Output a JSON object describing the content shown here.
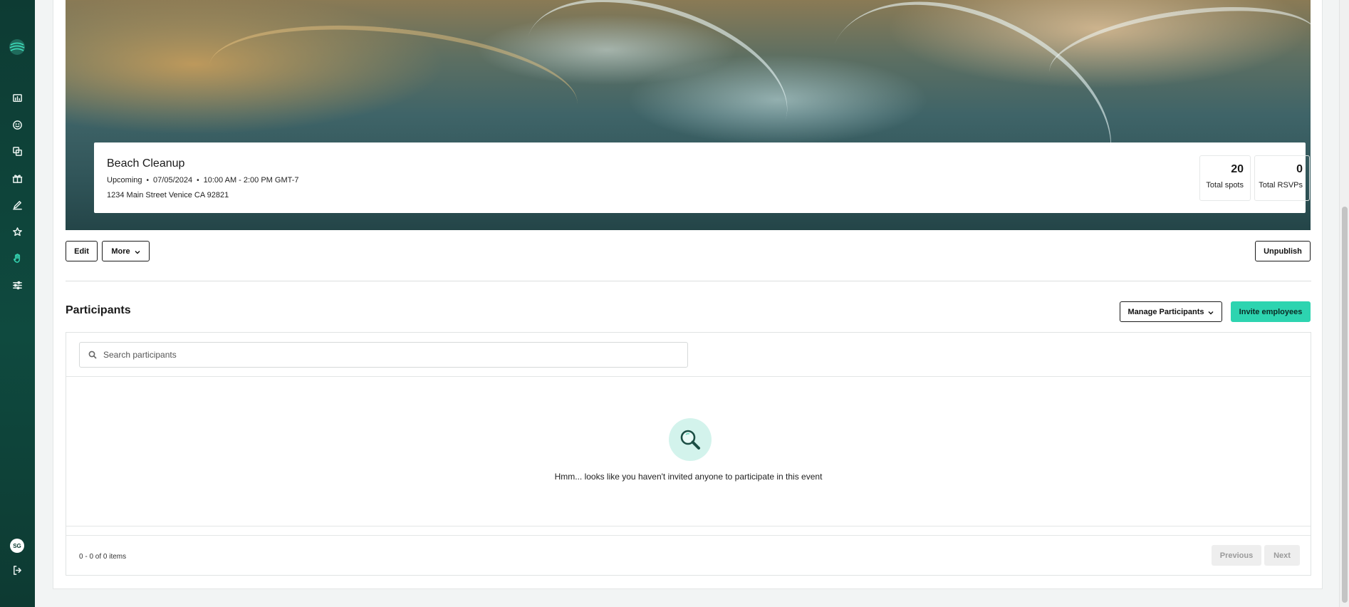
{
  "sidebar": {
    "avatar_initials": "SG",
    "items": [
      {
        "icon": "chart-icon"
      },
      {
        "icon": "smiley-icon"
      },
      {
        "icon": "copy-icon"
      },
      {
        "icon": "gift-icon"
      },
      {
        "icon": "pen-icon"
      },
      {
        "icon": "star-icon"
      },
      {
        "icon": "hand-icon",
        "active": true
      },
      {
        "icon": "sliders-icon"
      }
    ],
    "accent_color": "#35d3b0"
  },
  "event": {
    "title": "Beach Cleanup",
    "status": "Upcoming",
    "date": "07/05/2024",
    "time": "10:00 AM - 2:00 PM GMT-7",
    "address": "1234 Main Street Venice CA 92821",
    "stats": [
      {
        "value": "20",
        "label": "Total spots"
      },
      {
        "value": "0",
        "label": "Total RSVPs"
      }
    ]
  },
  "actions": {
    "edit_label": "Edit",
    "more_label": "More",
    "unpublish_label": "Unpublish"
  },
  "participants": {
    "title": "Participants",
    "manage_label": "Manage Participants",
    "invite_label": "Invite employees",
    "search_placeholder": "Search participants",
    "empty_message": "Hmm... looks like you haven't invited anyone to participate in this event",
    "pagination_info": "0 - 0 of 0 items",
    "previous_label": "Previous",
    "next_label": "Next"
  },
  "colors": {
    "primary": "#2dd4b0",
    "sidebar_bg": "#0d3b33"
  }
}
